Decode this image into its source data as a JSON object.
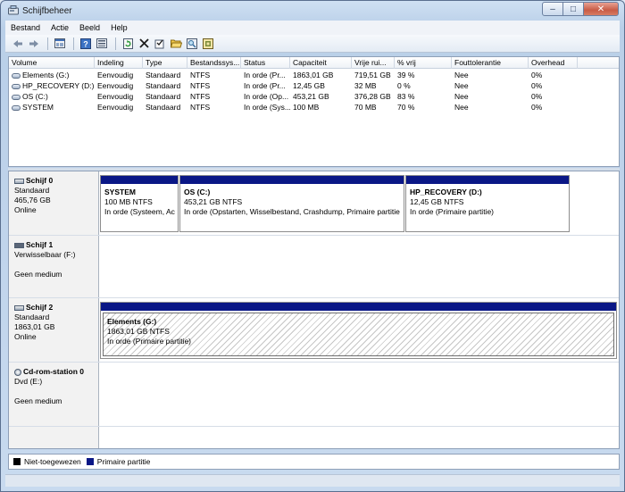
{
  "window": {
    "title": "Schijfbeheer"
  },
  "menu": [
    "Bestand",
    "Actie",
    "Beeld",
    "Help"
  ],
  "toolbar": {
    "icons": [
      "back-arrow-icon",
      "forward-arrow-icon",
      "properties-icon",
      "help-icon",
      "refresh-icon",
      "delete-icon",
      "checklist-icon",
      "open-folder-icon",
      "search-icon",
      "settings-icon"
    ]
  },
  "volume_list": {
    "columns": [
      "Volume",
      "Indeling",
      "Type",
      "Bestandssys...",
      "Status",
      "Capaciteit",
      "Vrije rui...",
      "% vrij",
      "Fouttolerantie",
      "Overhead"
    ],
    "rows": [
      [
        "Elements (G:)",
        "Eenvoudig",
        "Standaard",
        "NTFS",
        "In orde (Pr...",
        "1863,01 GB",
        "719,51 GB",
        "39 %",
        "Nee",
        "0%"
      ],
      [
        "HP_RECOVERY (D:)",
        "Eenvoudig",
        "Standaard",
        "NTFS",
        "In orde (Pr...",
        "12,45 GB",
        "32 MB",
        "0 %",
        "Nee",
        "0%"
      ],
      [
        "OS (C:)",
        "Eenvoudig",
        "Standaard",
        "NTFS",
        "In orde (Op...",
        "453,21 GB",
        "376,28 GB",
        "83 %",
        "Nee",
        "0%"
      ],
      [
        "SYSTEM",
        "Eenvoudig",
        "Standaard",
        "NTFS",
        "In orde (Sys...",
        "100 MB",
        "70 MB",
        "70 %",
        "Nee",
        "0%"
      ]
    ]
  },
  "disks": [
    {
      "name": "Schijf 0",
      "type": "Standaard",
      "size": "465,76 GB",
      "status": "Online",
      "partitions": [
        {
          "name": "SYSTEM",
          "size": "100 MB NTFS",
          "status": "In orde (Systeem, Ac"
        },
        {
          "name": "OS  (C:)",
          "size": "453,21 GB NTFS",
          "status": "In orde (Opstarten, Wisselbestand, Crashdump, Primaire partitie"
        },
        {
          "name": "HP_RECOVERY  (D:)",
          "size": "12,45 GB NTFS",
          "status": "In orde (Primaire partitie)"
        }
      ]
    },
    {
      "name": "Schijf 1",
      "type": "Verwisselbaar (F:)",
      "size": "",
      "status": "Geen medium",
      "partitions": []
    },
    {
      "name": "Schijf 2",
      "type": "Standaard",
      "size": "1863,01 GB",
      "status": "Online",
      "partitions": [
        {
          "name": "Elements  (G:)",
          "size": "1863,01 GB NTFS",
          "status": "In orde (Primaire partitie)"
        }
      ]
    },
    {
      "name": "Cd-rom-station 0",
      "type": "Dvd (E:)",
      "size": "",
      "status": "Geen medium",
      "partitions": []
    }
  ],
  "legend": [
    {
      "label": "Niet-toegewezen",
      "color": "#000000"
    },
    {
      "label": "Primaire partitie",
      "color": "#0a1786"
    }
  ]
}
